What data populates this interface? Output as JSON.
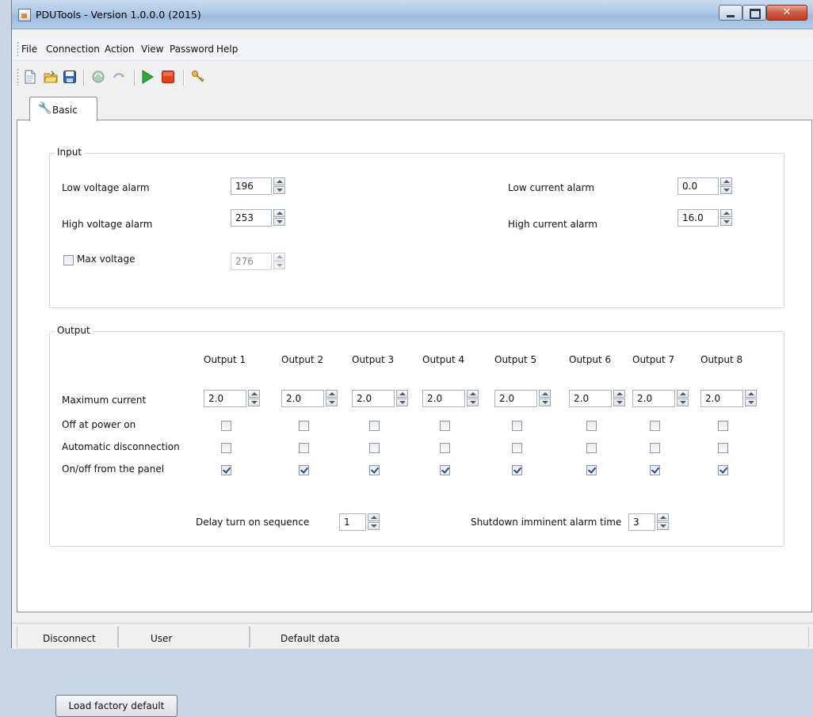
{
  "window": {
    "title": "PDUTools - Version 1.0.0.0 (2015)"
  },
  "menu": [
    "File",
    "Connection",
    "Action",
    "View",
    "Password",
    "Help"
  ],
  "toolbar": {
    "icons": [
      "new-file-icon",
      "open-folder-icon",
      "save-icon",
      "refresh-icon",
      "sync-icon",
      "play-icon",
      "stop-icon",
      "keys-icon"
    ]
  },
  "tabs": [
    "Basic"
  ],
  "input": {
    "title": "Input",
    "low_voltage_label": "Low voltage alarm",
    "low_voltage_value": "196",
    "high_voltage_label": "High voltage alarm",
    "high_voltage_value": "253",
    "max_voltage_label": "Max voltage",
    "max_voltage_value": "276",
    "max_voltage_checked": false,
    "low_current_label": "Low current alarm",
    "low_current_value": "0.0",
    "high_current_label": "High current alarm",
    "high_current_value": "16.0"
  },
  "output": {
    "title": "Output",
    "row_labels": {
      "max_current": "Maximum current",
      "off_power_on": "Off at power on",
      "auto_disconnect": "Automatic disconnection",
      "onoff_panel": "On/off from the panel"
    },
    "columns": [
      {
        "name": "Output 1",
        "max_current": "2.0",
        "off_power_on": false,
        "auto_disconnect": false,
        "onoff_panel": true
      },
      {
        "name": "Output 2",
        "max_current": "2.0",
        "off_power_on": false,
        "auto_disconnect": false,
        "onoff_panel": true
      },
      {
        "name": "Output 3",
        "max_current": "2.0",
        "off_power_on": false,
        "auto_disconnect": false,
        "onoff_panel": true
      },
      {
        "name": "Output 4",
        "max_current": "2.0",
        "off_power_on": false,
        "auto_disconnect": false,
        "onoff_panel": true
      },
      {
        "name": "Output 5",
        "max_current": "2.0",
        "off_power_on": false,
        "auto_disconnect": false,
        "onoff_panel": true
      },
      {
        "name": "Output 6",
        "max_current": "2.0",
        "off_power_on": false,
        "auto_disconnect": false,
        "onoff_panel": true
      },
      {
        "name": "Output 7",
        "max_current": "2.0",
        "off_power_on": false,
        "auto_disconnect": false,
        "onoff_panel": true
      },
      {
        "name": "Output 8",
        "max_current": "2.0",
        "off_power_on": false,
        "auto_disconnect": false,
        "onoff_panel": true
      }
    ],
    "delay_label": "Delay turn on sequence",
    "delay_value": "1",
    "shutdown_label": "Shutdown imminent alarm time",
    "shutdown_value": "3"
  },
  "buttons": {
    "factory_default": "Load factory default"
  },
  "status": [
    "Disconnect",
    "User",
    "Default data"
  ]
}
